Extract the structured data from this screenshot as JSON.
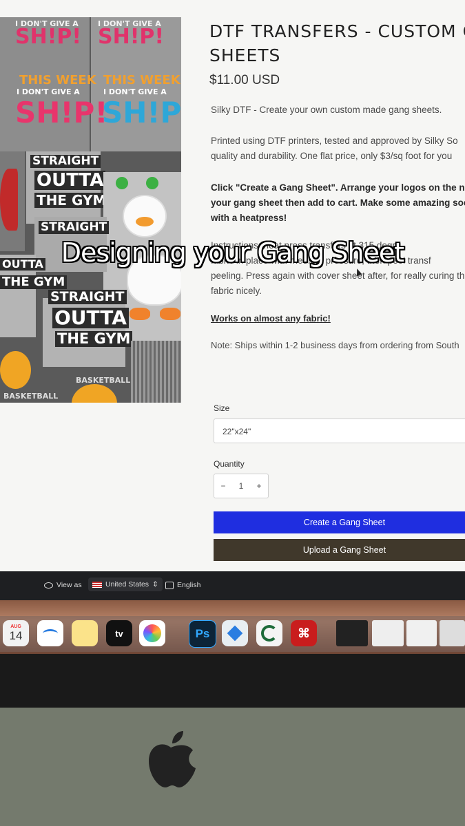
{
  "product": {
    "title_line1": "DTF TRANSFERS - CUSTOM G",
    "title_line2": "SHEETS",
    "price": "$11.00 USD",
    "desc1": "Silky DTF - Create your own custom made gang sheets.",
    "desc2a": "Printed using DTF printers, tested and approved by Silky So",
    "desc2b": "quality and durability.  One flat price, only $3/sq foot for you",
    "desc3a": "Click \"Create a Gang Sheet\". Arrange your logos on the nex",
    "desc3b": "your gang sheet then add to cart. Make some amazing sock",
    "desc3c": "with a heatpress!",
    "desc4a": "Instructions: heat press transfers at 315 degre",
    "desc4b": "fabric in place with medium pressure, then peel transf",
    "desc4c": "peeling. Press again with cover sheet after, for really curing th",
    "desc4d": "fabric nicely.",
    "fabric_link": "Works on almost any fabric!",
    "note": "Note: Ships within 1-2 business days from ordering from South"
  },
  "form": {
    "size_label": "Size",
    "size_value": "22\"x24\"",
    "quantity_label": "Quantity",
    "minus": "−",
    "quantity_value": "1",
    "plus": "+",
    "create_button": "Create a Gang Sheet",
    "upload_button": "Upload a Gang Sheet"
  },
  "caption": "Designing your Gang Sheet",
  "admin_bar": {
    "view_as": "View as",
    "country": "United States",
    "language": "English"
  },
  "stickers": {
    "give_a_top": "I DON'T GIVE A",
    "ship": "SH!P!",
    "this_week": "THIS WEEK",
    "straight": "STRAIGHT",
    "outta": "OUTTA",
    "the_gym": "THE GYM",
    "basketball": "BASKETBALL"
  },
  "dock": {
    "calendar_month": "AUG",
    "calendar_day": "14",
    "tv_label": "tv",
    "photoshop": "Ps"
  },
  "colors": {
    "create_button": "#1f2ee0",
    "upload_button": "#40382b",
    "admin_bar": "#1e1f22"
  }
}
